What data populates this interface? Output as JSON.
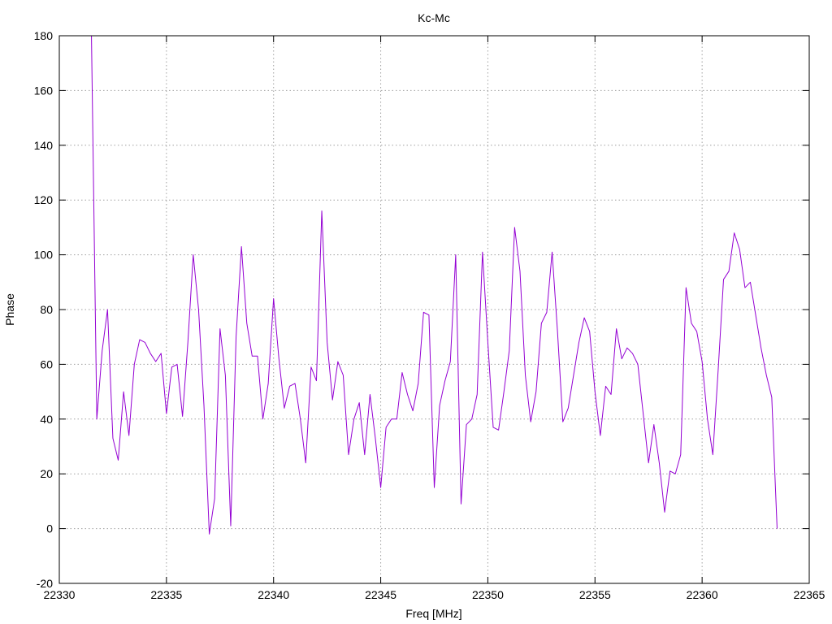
{
  "chart_data": {
    "type": "line",
    "title": "Kc-Mc",
    "xlabel": "Freq [MHz]",
    "ylabel": "Phase",
    "xlim": [
      22330,
      22365
    ],
    "ylim": [
      -20,
      180
    ],
    "xticks": [
      22330,
      22335,
      22340,
      22345,
      22350,
      22355,
      22360,
      22365
    ],
    "yticks": [
      -20,
      0,
      20,
      40,
      60,
      80,
      100,
      120,
      140,
      160,
      180
    ],
    "grid": true,
    "legend": "none",
    "series": [
      {
        "color": "#9400d3",
        "x": [
          22331.5,
          22331.75,
          22332.0,
          22332.25,
          22332.5,
          22332.75,
          22333.0,
          22333.25,
          22333.5,
          22333.75,
          22334.0,
          22334.25,
          22334.5,
          22334.75,
          22335.0,
          22335.25,
          22335.5,
          22335.75,
          22336.0,
          22336.25,
          22336.5,
          22336.75,
          22337.0,
          22337.25,
          22337.5,
          22337.75,
          22338.0,
          22338.25,
          22338.5,
          22338.75,
          22339.0,
          22339.25,
          22339.5,
          22339.75,
          22340.0,
          22340.25,
          22340.5,
          22340.75,
          22341.0,
          22341.25,
          22341.5,
          22341.75,
          22342.0,
          22342.25,
          22342.5,
          22342.75,
          22343.0,
          22343.25,
          22343.5,
          22343.75,
          22344.0,
          22344.25,
          22344.5,
          22344.75,
          22345.0,
          22345.25,
          22345.5,
          22345.75,
          22346.0,
          22346.25,
          22346.5,
          22346.75,
          22347.0,
          22347.25,
          22347.5,
          22347.75,
          22348.0,
          22348.25,
          22348.5,
          22348.75,
          22349.0,
          22349.25,
          22349.5,
          22349.75,
          22350.0,
          22350.25,
          22350.5,
          22350.75,
          22351.0,
          22351.25,
          22351.5,
          22351.75,
          22352.0,
          22352.25,
          22352.5,
          22352.75,
          22353.0,
          22353.25,
          22353.5,
          22353.75,
          22354.0,
          22354.25,
          22354.5,
          22354.75,
          22355.0,
          22355.25,
          22355.5,
          22355.75,
          22356.0,
          22356.25,
          22356.5,
          22356.75,
          22357.0,
          22357.25,
          22357.5,
          22357.75,
          22358.0,
          22358.25,
          22358.5,
          22358.75,
          22359.0,
          22359.25,
          22359.5,
          22359.75,
          22360.0,
          22360.25,
          22360.5,
          22360.75,
          22361.0,
          22361.25,
          22361.5,
          22361.75,
          22362.0,
          22362.25,
          22362.5,
          22362.75,
          22363.0,
          22363.25,
          22363.5
        ],
        "y": [
          180,
          40,
          65,
          80,
          33,
          25,
          50,
          34,
          60,
          69,
          68,
          64,
          61,
          64,
          42,
          59,
          60,
          41,
          68,
          100,
          80,
          45,
          -2,
          11,
          73,
          56,
          1,
          70,
          103,
          75,
          63,
          63,
          40,
          53,
          84,
          62,
          44,
          52,
          53,
          40,
          24,
          59,
          54,
          116,
          68,
          47,
          61,
          56,
          27,
          40,
          46,
          27,
          49,
          33,
          15,
          37,
          40,
          40,
          57,
          49,
          43,
          53,
          79,
          78,
          15,
          45,
          54,
          61,
          100,
          9,
          38,
          40,
          49,
          101,
          68,
          37,
          36,
          50,
          65,
          110,
          94,
          56,
          39,
          50,
          75,
          79,
          101,
          72,
          39,
          44,
          56,
          68,
          77,
          72,
          50,
          34,
          52,
          49,
          73,
          62,
          66,
          64,
          60,
          42,
          24,
          38,
          24,
          6,
          21,
          20,
          27,
          88,
          75,
          72,
          61,
          40,
          27,
          58,
          91,
          94,
          108,
          102,
          88,
          90,
          78,
          66,
          56,
          48,
          0
        ]
      }
    ]
  }
}
